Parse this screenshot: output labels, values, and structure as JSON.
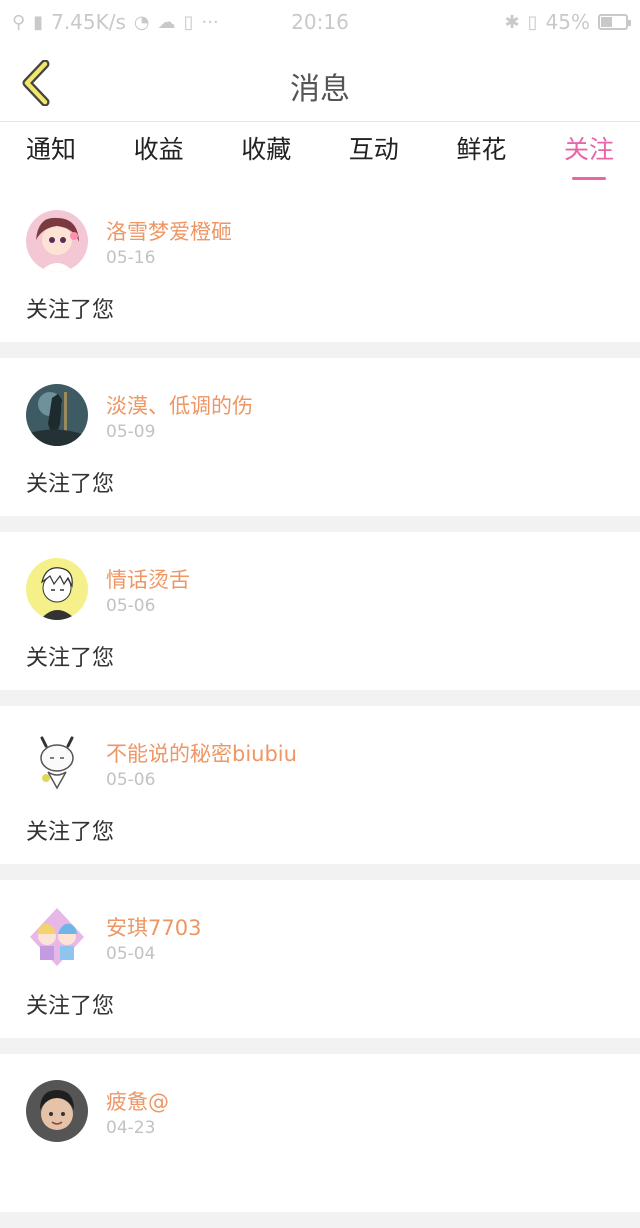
{
  "status_bar": {
    "network_speed": "7.45K/s",
    "time": "20:16",
    "battery": "45%",
    "battery_level": 0.45
  },
  "header": {
    "title": "消息",
    "back_icon": "chevron-left-icon",
    "accent_color": "#e965a8"
  },
  "tabs": [
    {
      "label": "通知",
      "active": false
    },
    {
      "label": "收益",
      "active": false
    },
    {
      "label": "收藏",
      "active": false
    },
    {
      "label": "互动",
      "active": false
    },
    {
      "label": "鲜花",
      "active": false
    },
    {
      "label": "关注",
      "active": true
    }
  ],
  "messages": [
    {
      "name": "洛雪梦爱橙砸",
      "date": "05-16",
      "action": "关注了您",
      "avatar_color": "#f3c7d3"
    },
    {
      "name": "淡漠、低调的伤",
      "date": "05-09",
      "action": "关注了您",
      "avatar_color": "#3e5a63"
    },
    {
      "name": "情话烫舌",
      "date": "05-06",
      "action": "关注了您",
      "avatar_color": "#f5f08a"
    },
    {
      "name": "不能说的秘密biubiu",
      "date": "05-06",
      "action": "关注了您",
      "avatar_color": "#ffffff"
    },
    {
      "name": "安琪7703",
      "date": "05-04",
      "action": "关注了您",
      "avatar_color": "#e7b7e8"
    },
    {
      "name": "疲惫@",
      "date": "04-23",
      "action": "",
      "avatar_color": "#555555"
    }
  ]
}
